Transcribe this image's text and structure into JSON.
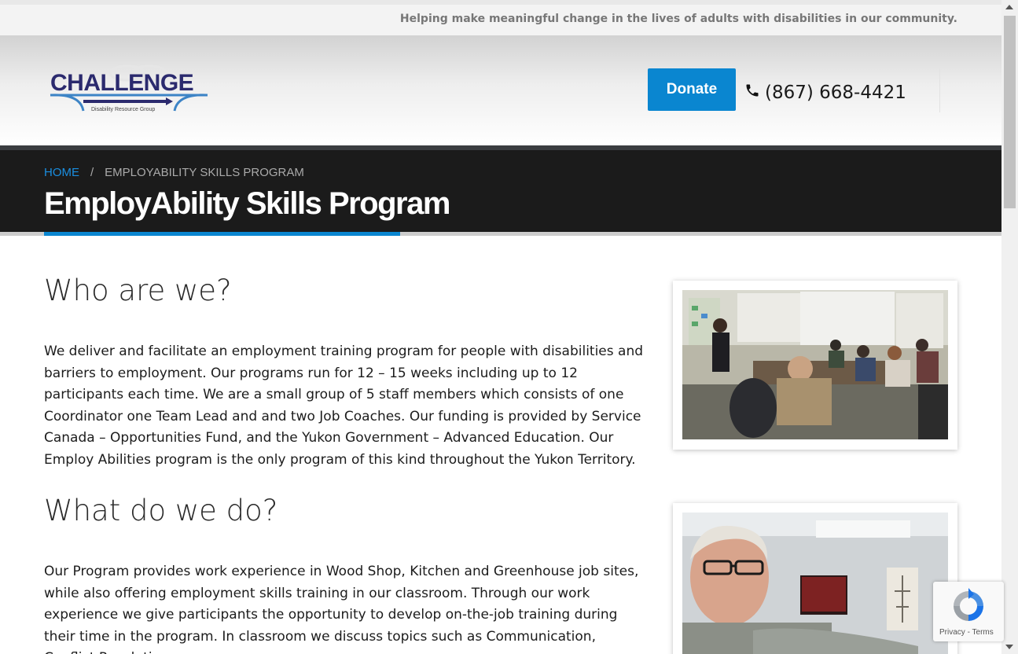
{
  "topbar": {
    "tagline": "Helping make meaningful change in the lives of adults with disabilities in our community."
  },
  "header": {
    "logo_text": "CHALLENGE",
    "logo_subtext": "Disability Resource Group",
    "donate_label": "Donate",
    "phone": "(867) 668-4421"
  },
  "breadcrumb": {
    "home": "HOME",
    "separator": "/",
    "current": "EMPLOYABILITY SKILLS PROGRAM"
  },
  "page_title": "EmployAbility Skills Program",
  "sections": [
    {
      "heading": "Who are we?",
      "body": "We deliver and facilitate an employment training program for people with disabilities and barriers to employment.  Our programs run for 12 – 15 weeks including up to 12 participants each time.  We are a small group of 5 staff members which consists of one Coordinator one Team Lead and and two Job Coaches.  Our funding is provided by Service Canada – Opportunities Fund, and the Yukon Government – Advanced Education.  Our Employ Abilities program is the only program of this kind throughout the Yukon Territory."
    },
    {
      "heading": "What do we do?",
      "body": "Our Program provides work experience in Wood Shop, Kitchen and Greenhouse job sites, while also offering employment skills training in our classroom. Through our work experience we give participants the opportunity to develop on-the-job training during their time in the program. In classroom we discuss topics such as Communication, Conflict Resolution,"
    }
  ],
  "recaptcha": {
    "privacy": "Privacy",
    "dash": " - ",
    "terms": "Terms"
  },
  "colors": {
    "accent": "#0a86d0",
    "band": "#1b1b1b",
    "logo_navy": "#2b2a6e",
    "logo_blue": "#3d84c6"
  },
  "icons": {
    "phone": "phone-icon",
    "recaptcha": "recaptcha-icon"
  }
}
